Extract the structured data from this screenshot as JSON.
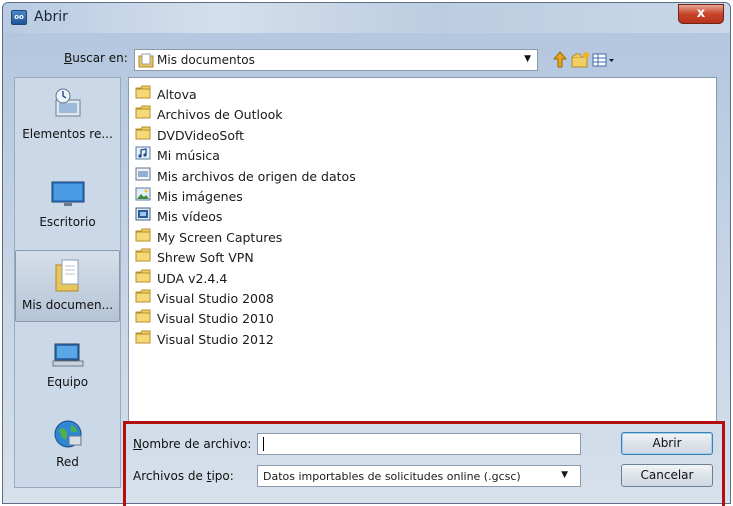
{
  "window": {
    "title": "Abrir",
    "close_label": "x"
  },
  "lookin": {
    "label_prefix": "",
    "label_accel": "B",
    "label_rest": "uscar en:",
    "value": "Mis documentos"
  },
  "toolbar": {
    "up_icon": "up-folder-icon",
    "newfolder_icon": "new-folder-icon",
    "view_icon": "view-menu-icon"
  },
  "places": [
    {
      "label": "Elementos re...",
      "icon": "recent-items-icon"
    },
    {
      "label": "Escritorio",
      "icon": "desktop-icon"
    },
    {
      "label": "Mis documen...",
      "icon": "documents-icon",
      "selected": true
    },
    {
      "label": "Equipo",
      "icon": "computer-icon"
    },
    {
      "label": "Red",
      "icon": "network-icon"
    }
  ],
  "files": [
    {
      "name": "Altova",
      "icon": "folder"
    },
    {
      "name": "Archivos de Outlook",
      "icon": "folder"
    },
    {
      "name": "DVDVideoSoft",
      "icon": "folder"
    },
    {
      "name": "Mi música",
      "icon": "music"
    },
    {
      "name": "Mis archivos de origen de datos",
      "icon": "datasource"
    },
    {
      "name": "Mis imágenes",
      "icon": "pictures"
    },
    {
      "name": "Mis vídeos",
      "icon": "videos"
    },
    {
      "name": "My Screen Captures",
      "icon": "folder"
    },
    {
      "name": "Shrew Soft VPN",
      "icon": "folder"
    },
    {
      "name": "UDA v2.4.4",
      "icon": "folder"
    },
    {
      "name": "Visual Studio 2008",
      "icon": "folder"
    },
    {
      "name": "Visual Studio 2010",
      "icon": "folder"
    },
    {
      "name": "Visual Studio 2012",
      "icon": "folder"
    }
  ],
  "filename": {
    "label_accel": "N",
    "label_rest": "ombre de archivo:",
    "value": ""
  },
  "filetype": {
    "label_pre": "Archivos de ",
    "label_accel": "t",
    "label_rest": "ipo:",
    "value": "Datos importables de solicitudes online (.gcsc)"
  },
  "buttons": {
    "open": "Abrir",
    "cancel": "Cancelar"
  },
  "colors": {
    "highlight_box": "#b20e0e",
    "selected_place": "#b5c4d6"
  }
}
